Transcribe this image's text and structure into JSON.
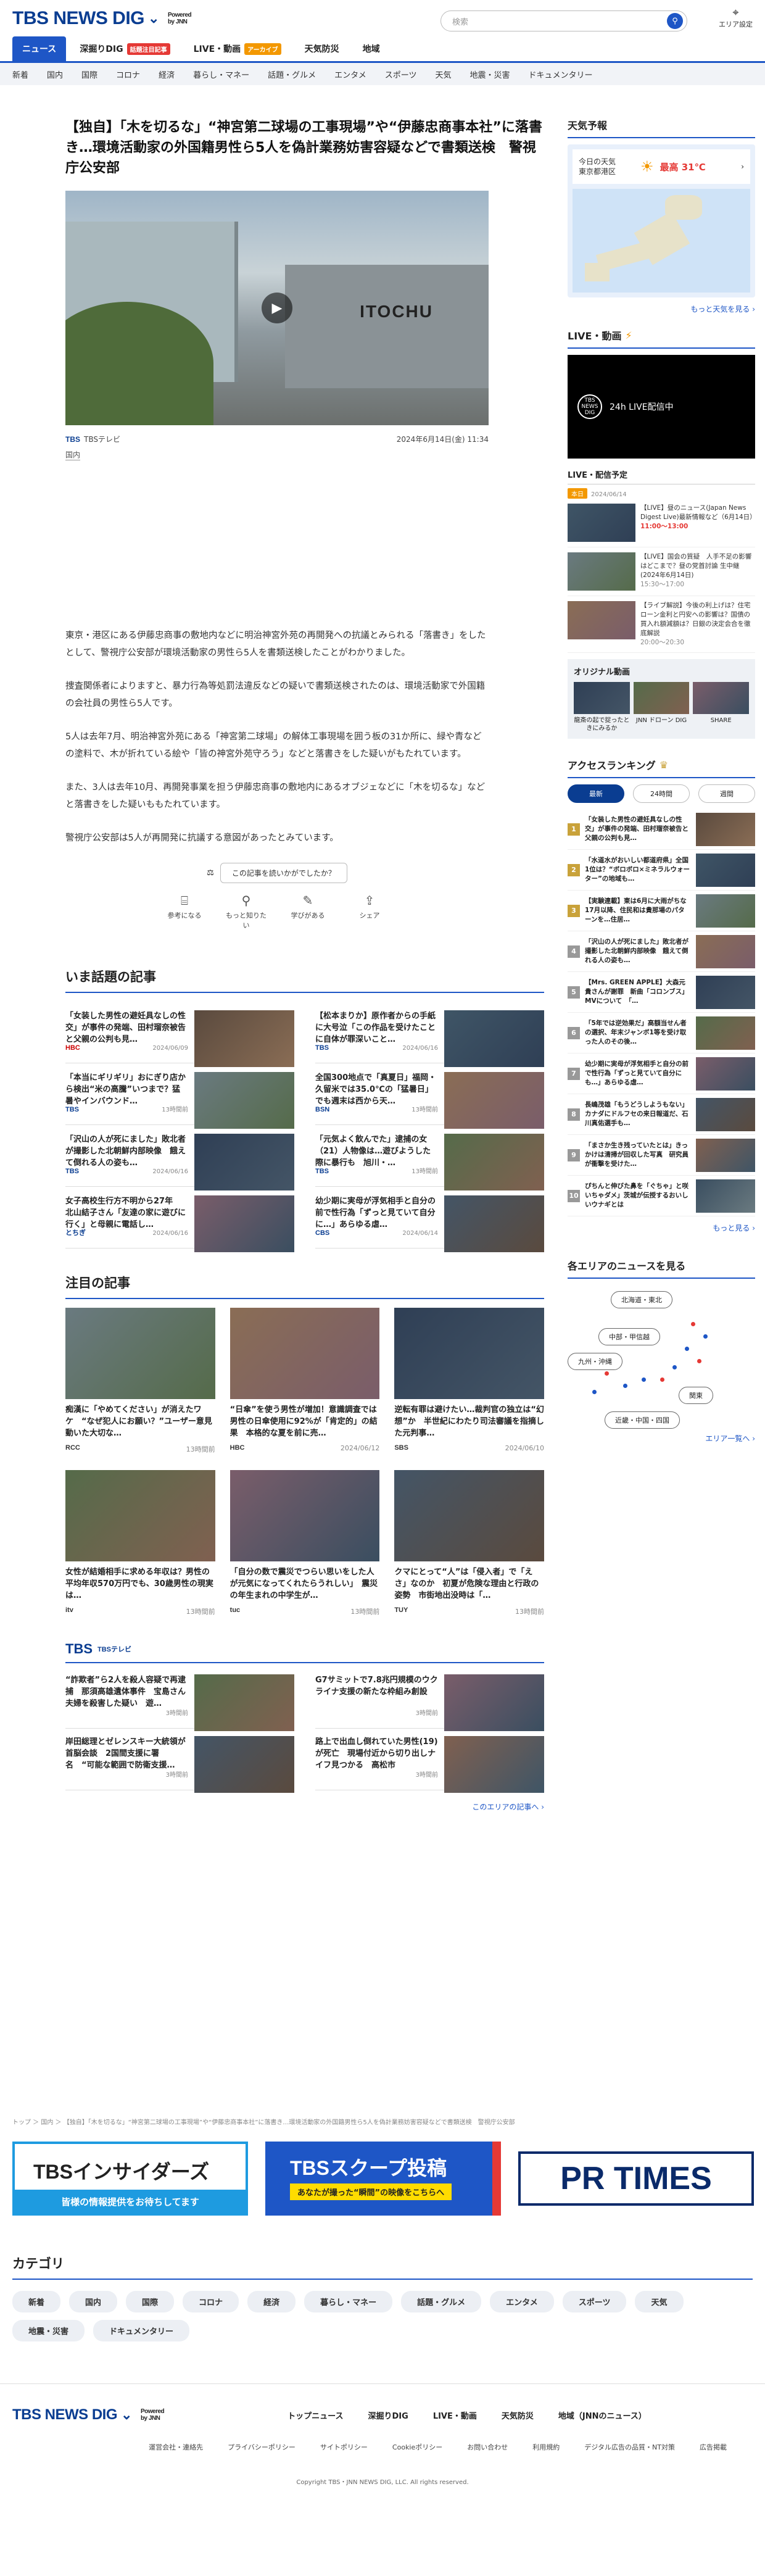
{
  "header": {
    "logo_text": "TBS NEWS DIG",
    "powered_line1": "Powered",
    "powered_line2": "by JNN",
    "search_placeholder": "検索",
    "area_label": "エリア設定"
  },
  "nav": {
    "tabs": [
      {
        "label": "ニュース",
        "active": true
      },
      {
        "label": "深掘りDIG",
        "badge": "話題注目記事"
      },
      {
        "label": "LIVE・動画",
        "badge": "アーカイブ"
      },
      {
        "label": "天気防災"
      },
      {
        "label": "地域"
      }
    ],
    "subnav": [
      "新着",
      "国内",
      "国際",
      "コロナ",
      "経済",
      "暮らし・マネー",
      "話題・グルメ",
      "エンタメ",
      "スポーツ",
      "天気",
      "地震・災害",
      "ドキュメンタリー"
    ]
  },
  "article": {
    "title": "【独自】「木を切るな」“神宮第二球場の工事現場”や“伊藤忠商事本社”に落書き…環境活動家の外国籍男性ら5人を偽計業務妨害容疑などで書類送検　警視庁公安部",
    "hero_sign": "ITOCHU",
    "source": "TBSテレビ",
    "source_logo": "TBS",
    "date": "2024年6月14日(金) 11:34",
    "category": "国内",
    "paragraphs": [
      "東京・港区にある伊藤忠商事の敷地内などに明治神宮外苑の再開発への抗議とみられる「落書き」をしたとして、警視庁公安部が環境活動家の男性ら5人を書類送検したことがわかりました。",
      "捜査関係者によりますと、暴力行為等処罰法違反などの疑いで書類送検されたのは、環境活動家で外国籍の会社員の男性ら5人です。",
      "5人は去年7月、明治神宮外苑にある「神宮第二球場」の解体工事現場を囲う板の31か所に、緑や青などの塗料で、木が折れている絵や「皆の神宮外苑守ろう」などと落書きをした疑いがもたれています。",
      "また、3人は去年10月、再開発事業を担う伊藤忠商事の敷地内にあるオブジェなどに「木を切るな」などと落書きをした疑いももたれています。",
      "警視庁公安部は5人が再開発に抗議する意図があったとみています。"
    ],
    "feedback_question": "この記事を読いかがでしたか？",
    "feedback_options": [
      "参考になる",
      "もっと知りたい",
      "学びがある",
      "シェア"
    ]
  },
  "wadai": {
    "heading": "いま話題の記事",
    "items": [
      {
        "title": "「女装した男性の避妊具なしの性交」が事件の発端、田村瑠奈被告と父親の公判も見…",
        "source": "HBC",
        "date": "2024/06/09",
        "color": "#c00"
      },
      {
        "title": "【松本まりか】原作者からの手紙に大号泣「この作品を受けたことに自体が罪深いこと…",
        "source": "TBS",
        "date": "2024/06/16",
        "color": "#0a3d91"
      },
      {
        "title": "「本当にギリギリ」おにぎり店から検出“米の高騰”いつまで？猛暑やインバウンド…",
        "source": "TBS",
        "date": "13時間前",
        "color": "#0a3d91"
      },
      {
        "title": "全国300地点で「真夏日」福岡・久留米では35.0℃の「猛暑日」でも週末は西から天…",
        "source": "BSN",
        "date": "13時間前",
        "color": "#0a3d91"
      },
      {
        "title": "「沢山の人が死にました」敗北者が撮影した北朝鮮内部映像　餓えて倒れる人の姿も…",
        "source": "TBS",
        "date": "2024/06/16",
        "color": "#0a3d91"
      },
      {
        "title": "「元気よく飲んでた」逮捕の女（21）人物像は…遊びようした際に暴行も　旭川・…",
        "source": "TBS",
        "date": "13時間前",
        "color": "#0a3d91"
      },
      {
        "title": "女子高校生行方不明から27年　北山結子さん「友達の家に遊びに行く」と母親に電話し…",
        "source": "とちぎ",
        "date": "2024/06/16",
        "color": "#0a3d91"
      },
      {
        "title": "幼少期に実母が浮気相手と自分の前で性行為「ずっと見ていて自分に…」あらゆる虐…",
        "source": "CBS",
        "date": "2024/06/14",
        "color": "#0a3d91"
      }
    ]
  },
  "chumoku": {
    "heading": "注目の記事",
    "items": [
      {
        "title": "痴漢に「やめてください」が消えたワケ　“なぜ犯人にお願い？”ユーザー意見動いた大切な…",
        "source": "RCC",
        "date": "13時間前"
      },
      {
        "title": "“日傘”を使う男性が増加！意識調査では男性の日傘使用に92%が「肯定的」の結果　本格的な夏を前に売…",
        "source": "HBC",
        "date": "2024/06/12"
      },
      {
        "title": "逆転有罪は避けたい…裁判官の独立は“幻想”か　半世紀にわたり司法審議を指摘した元判事…",
        "source": "SBS",
        "date": "2024/06/10"
      },
      {
        "title": "女性が結婚相手に求める年収は？男性の平均年収570万円でも、30歳男性の現実は…",
        "source": "itv",
        "date": "13時間前"
      },
      {
        "title": "「自分の数で震災でつらい思いをした人が元気になってくれたらうれしい」　震災の年生まれの中学生が…",
        "source": "tuc",
        "date": "13時間前"
      },
      {
        "title": "クマにとって“人”は「侵入者」で「えさ」なのか　初夏が危険な理由と行政の姿勢　市街地出没時は「…",
        "source": "TUY",
        "date": "13時間前"
      }
    ]
  },
  "tbs_section": {
    "heading": "TBS",
    "sub": "TBSテレビ",
    "items": [
      {
        "title": "“詐欺者”ら2人を殺人容疑で再逮捕　那須高雄遺体事件　宝島さん夫婦を殺害した疑い　遊…",
        "date": "3時間前"
      },
      {
        "title": "G7サミットで7.8兆円規模のウクライナ支援の新たな枠組み創設",
        "date": "3時間前"
      },
      {
        "title": "岸田総理とゼレンスキー大統領が首脳会談　2国間支援に署名　“可能な範囲で防衛支援…",
        "date": "3時間前"
      },
      {
        "title": "路上で出血し倒れていた男性(19)が死亡　現場付近から切り出しナイフ見つかる　高松市",
        "date": "3時間前"
      }
    ],
    "more": "このエリアの記事へ ›"
  },
  "side": {
    "weather": {
      "heading": "天気予報",
      "location_line1": "今日の天気",
      "location_line2": "東京都港区",
      "high": "最高 31℃",
      "more": "もっと天気を見る ›"
    },
    "live": {
      "heading": "LIVE・動画",
      "player_icon": "TBS NEWS DIG",
      "player_title": "24h LIVE配信中",
      "schedule_heading": "LIVE・配信予定",
      "date_badge": "本日",
      "date": "2024/06/14",
      "items": [
        {
          "title": "【LIVE】昼のニュース(Japan News Digest Live)最新情報など（6月14日）",
          "time": "11:00〜13:00",
          "on": true
        },
        {
          "title": "【LIVE】国会の質疑　人手不足の影響はどこまで？昼の党首討論 生中継(2024年6月14日)",
          "time": "15:30〜17:00",
          "on": false
        },
        {
          "title": "【ライブ解説】今後の利上げは？住宅ローン金利と円安への影響は？国債の買入れ額減額は？日銀の決定会合を徹底解説",
          "time": "20:00〜20:30",
          "on": false
        }
      ],
      "original_heading": "オリジナル動画",
      "originals": [
        "龍斎の起で捉ったときにみるか",
        "JNN ドローン DIG",
        "SHARE"
      ]
    },
    "ranking": {
      "heading": "アクセスランキング",
      "tabs": [
        "最新",
        "24時間",
        "週間"
      ],
      "items": [
        "「女装した男性の避妊具なしの性交」が事件の発端、田村瑠奈被告と父親の公判も見…",
        "「水道水がおいしい都道府県」全国1位は？“ボロボロ×ミネラルウォーター”の地域も…",
        "【実験連載】東は6月に大雨がちな17月以降、住民和は貴那場のパターンを…住居…",
        "「沢山の人が死にました」敗北者が撮影した北朝鮮内部映像　餓えて倒れる人の姿も…",
        "【Mrs. GREEN APPLE】大森元貴さんが謝罪　新曲「コロンブス」MVについて　「…",
        "「5年では逆効果だ」高額当せん者の選択、年末ジャンボ1等を受け取った人のその後…",
        "幼少期に実母が浮気相手と自分の前で性行為「ずっと見ていて自分にも…」あらゆる虐…",
        "長嶋茂雄「もうどうしようもない」カナダにドルフセの来日報道だ、石川真佑選手も…",
        "「まさか生き残っていたとは」きっかけは清掃が回収した写真　研究員が衝撃を受けた…",
        "ぴちんと伸びた鼻を「ぐちゃ」と咲いちゃダメ」茨城が伝授するおいしいウナギとは"
      ],
      "more": "もっと見る ›"
    },
    "area": {
      "heading": "各エリアのニュースを見る",
      "buttons": [
        "北海道・東北",
        "中部・甲信越",
        "九州・沖縄",
        "関東",
        "近畿・中国・四国"
      ],
      "more": "エリア一覧へ ›"
    }
  },
  "breadcrumb": "トップ ＞ 国内 ＞ 【独自】「木を切るな」“神宮第二球場の工事現場”や“伊藤忠商事本社”に落書き…環境活動家の外国籍男性ら5人を偽計業務妨害容疑などで書類送検　警視庁公安部",
  "banners": [
    {
      "title": "TBSインサイダーズ",
      "sub": "皆様の情報提供をお待ちしてます"
    },
    {
      "title": "TBSスクープ投稿",
      "sub": "あなたが撮った“瞬間”の映像をこちらへ"
    },
    {
      "title": "PR TIMES"
    }
  ],
  "categories": {
    "heading": "カテゴリ",
    "items": [
      "新着",
      "国内",
      "国際",
      "コロナ",
      "経済",
      "暮らし・マネー",
      "話題・グルメ",
      "エンタメ",
      "スポーツ",
      "天気",
      "地震・災害",
      "ドキュメンタリー"
    ]
  },
  "footer": {
    "links": [
      "トップニュース",
      "深掘りDIG",
      "LIVE・動画",
      "天気防災",
      "地域（JNNのニュース）"
    ],
    "sublinks": [
      "運営会社・連絡先",
      "プライバシーポリシー",
      "サイトポリシー",
      "Cookieポリシー",
      "お問い合わせ",
      "利用規約",
      "デジタル広告の品質・NT対策",
      "広告掲載"
    ],
    "copyright": "Copyright TBS・JNN NEWS DIG, LLC. All rights reserved."
  },
  "colors": {
    "brand": "#0a3d91",
    "accent": "#1e56c6",
    "alert": "#e53935"
  }
}
